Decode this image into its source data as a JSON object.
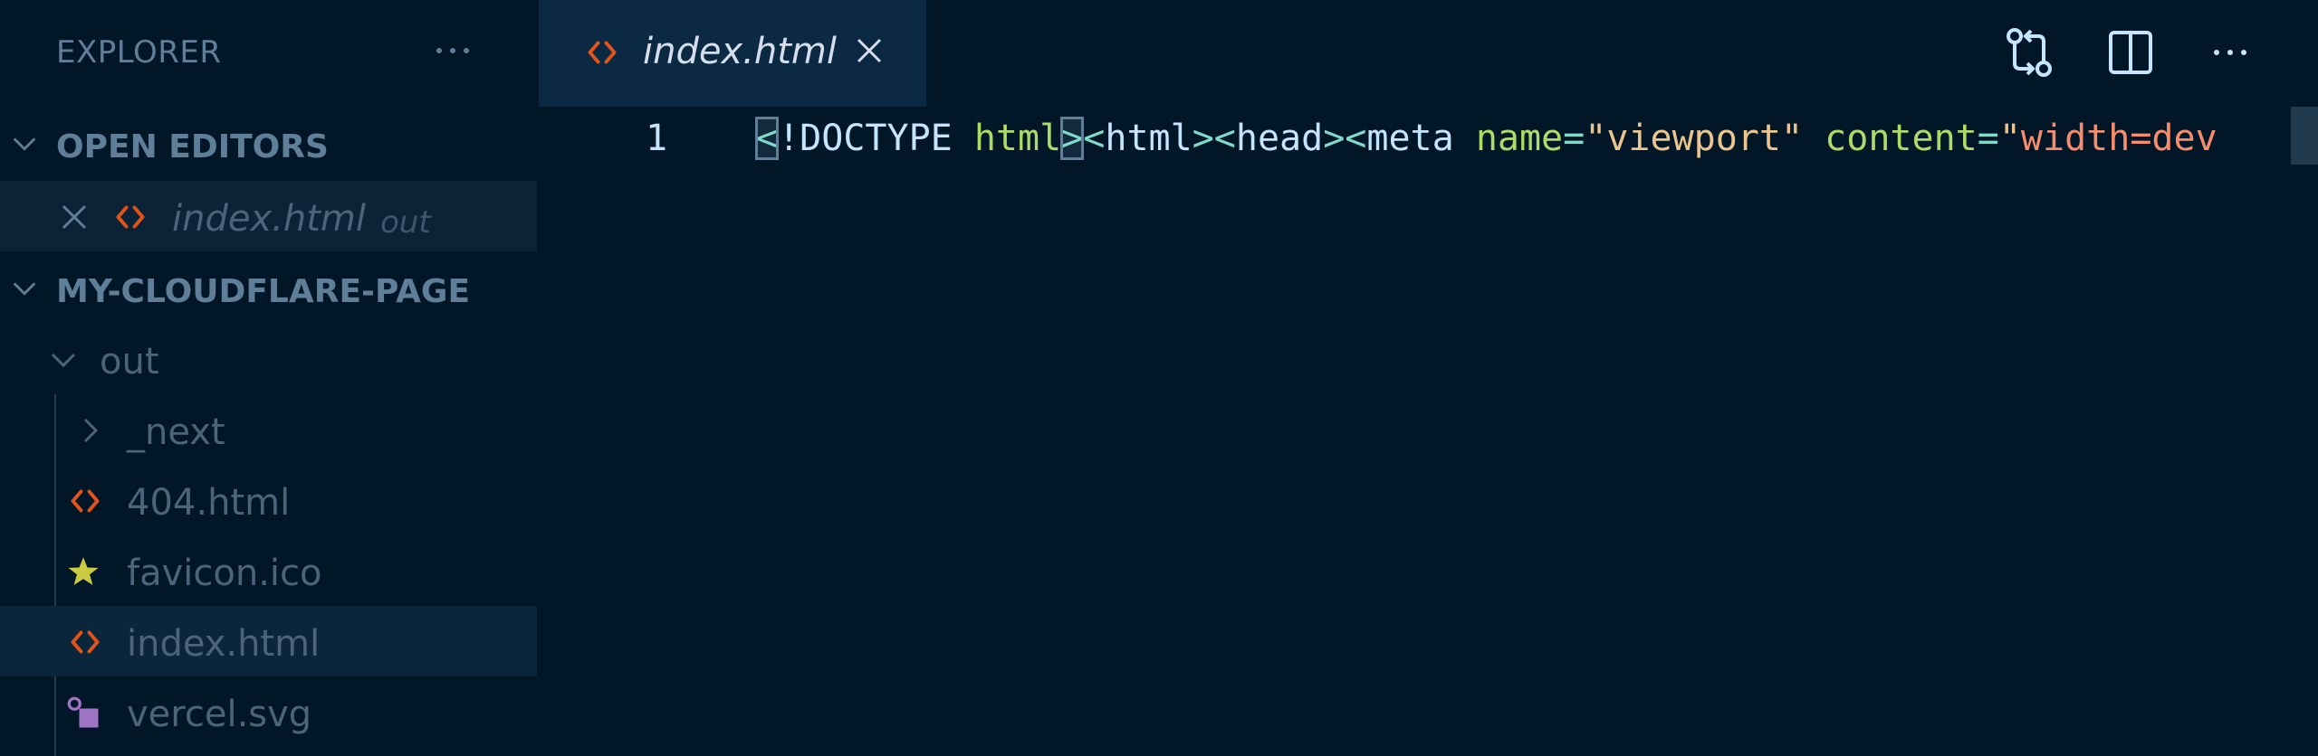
{
  "sidebar": {
    "title": "EXPLORER",
    "open_editors": {
      "label": "OPEN EDITORS",
      "items": [
        {
          "label": "index.html",
          "description": "out"
        }
      ]
    },
    "project": {
      "label": "MY-CLOUDFLARE-PAGE",
      "tree": [
        {
          "label": "out",
          "kind": "folder",
          "expanded": true
        },
        {
          "label": "_next",
          "kind": "folder",
          "expanded": false
        },
        {
          "label": "404.html",
          "kind": "html"
        },
        {
          "label": "favicon.ico",
          "kind": "icon"
        },
        {
          "label": "index.html",
          "kind": "html",
          "selected": true
        },
        {
          "label": "vercel.svg",
          "kind": "svg"
        }
      ]
    }
  },
  "editor": {
    "tab": {
      "label": "index.html"
    },
    "line_number": "1",
    "code": {
      "lt1": "<",
      "doctype": "!DOCTYPE",
      "html_attr": "html",
      "gt1": ">",
      "lt2": "<",
      "html_tag": "html",
      "gt2": ">",
      "lt3": "<",
      "head_tag": "head",
      "gt3": ">",
      "lt4": "<",
      "meta_tag": "meta",
      "name_attr": "name",
      "eq1": "=",
      "name_val": "\"viewport\"",
      "content_attr": "content",
      "eq2": "=",
      "content_q": "\"",
      "content_val": "width=de",
      "content_val_tail": "v"
    }
  },
  "colors": {
    "background": "#011627",
    "sidebar_text": "#5f7e97",
    "html_icon": "#e2541a",
    "favicon_icon": "#cbcb41",
    "svg_icon": "#a074c4",
    "tab_active": "#0b2942"
  },
  "icons": {
    "more": "ellipsis-icon",
    "chevron_open": "chevron-down-icon",
    "chevron_closed": "chevron-right-icon",
    "close": "close-icon",
    "html": "html-file-icon",
    "favicon": "star-icon",
    "svg": "svg-file-icon",
    "compare": "git-compare-icon",
    "split": "split-editor-icon"
  }
}
